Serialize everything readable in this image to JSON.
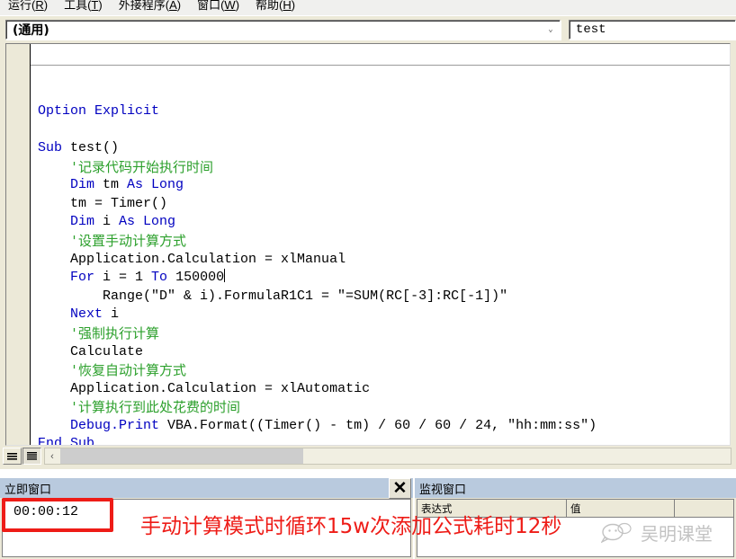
{
  "menu": {
    "items": [
      {
        "label": "运行(R)",
        "accel": "R"
      },
      {
        "label": "工具(T)",
        "accel": "T"
      },
      {
        "label": "外接程序(A)",
        "accel": "A"
      },
      {
        "label": "窗口(W)",
        "accel": "W"
      },
      {
        "label": "帮助(H)",
        "accel": "H"
      }
    ]
  },
  "code_window": {
    "object_combo_value": "(通用)",
    "procedure_combo_value": "test",
    "chevron": "⌄",
    "code_lines": [
      {
        "indent": 0,
        "spans": [
          {
            "t": "Option Explicit",
            "c": "kw"
          }
        ]
      },
      {
        "indent": 0,
        "spans": []
      },
      {
        "indent": 0,
        "spans": [
          {
            "t": "Sub ",
            "c": "kw"
          },
          {
            "t": "test()",
            "c": "txt"
          }
        ]
      },
      {
        "indent": 1,
        "spans": [
          {
            "t": "'记录代码开始执行时间",
            "c": "cmt"
          }
        ]
      },
      {
        "indent": 1,
        "spans": [
          {
            "t": "Dim ",
            "c": "kw"
          },
          {
            "t": "tm ",
            "c": "txt"
          },
          {
            "t": "As Long",
            "c": "kw"
          }
        ]
      },
      {
        "indent": 1,
        "spans": [
          {
            "t": "tm = Timer()",
            "c": "txt"
          }
        ]
      },
      {
        "indent": 1,
        "spans": [
          {
            "t": "Dim ",
            "c": "kw"
          },
          {
            "t": "i ",
            "c": "txt"
          },
          {
            "t": "As Long",
            "c": "kw"
          }
        ]
      },
      {
        "indent": 1,
        "spans": [
          {
            "t": "'设置手动计算方式",
            "c": "cmt"
          }
        ]
      },
      {
        "indent": 1,
        "spans": [
          {
            "t": "Application.Calculation = xlManual",
            "c": "txt"
          }
        ]
      },
      {
        "indent": 1,
        "spans": [
          {
            "t": "For ",
            "c": "kw"
          },
          {
            "t": "i = 1 ",
            "c": "txt"
          },
          {
            "t": "To ",
            "c": "kw"
          },
          {
            "t": "150000",
            "c": "txt"
          }
        ],
        "caret": true
      },
      {
        "indent": 2,
        "spans": [
          {
            "t": "Range(\"D\" & i).FormulaR1C1 = \"=SUM(RC[-3]:RC[-1])\"",
            "c": "txt"
          }
        ]
      },
      {
        "indent": 1,
        "spans": [
          {
            "t": "Next ",
            "c": "kw"
          },
          {
            "t": "i",
            "c": "txt"
          }
        ]
      },
      {
        "indent": 1,
        "spans": [
          {
            "t": "'强制执行计算",
            "c": "cmt"
          }
        ]
      },
      {
        "indent": 1,
        "spans": [
          {
            "t": "Calculate",
            "c": "txt"
          }
        ]
      },
      {
        "indent": 1,
        "spans": [
          {
            "t": "'恢复自动计算方式",
            "c": "cmt"
          }
        ]
      },
      {
        "indent": 1,
        "spans": [
          {
            "t": "Application.Calculation = xlAutomatic",
            "c": "txt"
          }
        ]
      },
      {
        "indent": 1,
        "spans": [
          {
            "t": "'计算执行到此处花费的时间",
            "c": "cmt"
          }
        ]
      },
      {
        "indent": 1,
        "spans": [
          {
            "t": "Debug.Print ",
            "c": "kw"
          },
          {
            "t": "VBA.Format((Timer() - tm) / 60 / 60 / 24, \"hh:mm:ss\")",
            "c": "txt"
          }
        ]
      },
      {
        "indent": 0,
        "spans": [
          {
            "t": "End Sub",
            "c": "kw"
          }
        ]
      }
    ],
    "view_buttons": {
      "procedure_view": "procedure-view-icon",
      "full_module_view": "full-module-view-icon"
    },
    "hscroll_left_arrow": "‹"
  },
  "immediate_window": {
    "title": "立即窗口",
    "close_label": "✕",
    "output": "00:00:12"
  },
  "watch_window": {
    "title": "监视窗口",
    "columns": [
      "表达式",
      "值"
    ],
    "rows": []
  },
  "annotations": {
    "note_text": "手动计算模式时循环15w次添加公式耗时12秒",
    "highlight_color": "#ee1c17"
  },
  "watermark": {
    "text": "吴明课堂"
  }
}
